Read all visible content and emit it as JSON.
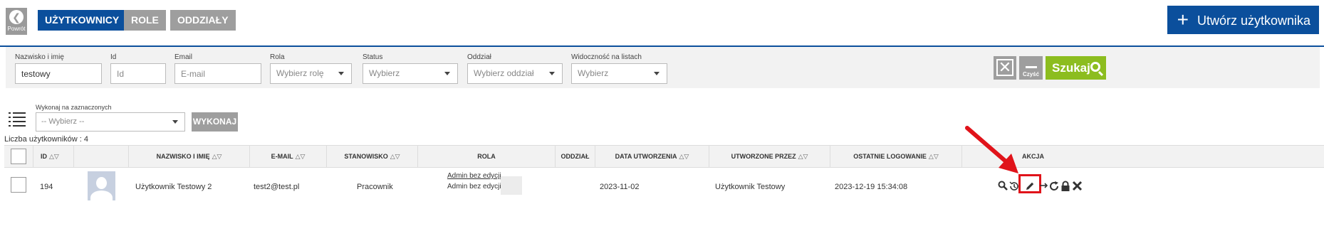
{
  "nav": {
    "back_label": "Powrót",
    "tabs": [
      {
        "label": "UŻYTKOWNICY",
        "active": true
      },
      {
        "label": "ROLE",
        "active": false
      },
      {
        "label": "ODDZIAŁY",
        "active": false
      }
    ],
    "create_label": "Utwórz użytkownika"
  },
  "filters": {
    "name": {
      "label": "Nazwisko i imię",
      "value": "testowy"
    },
    "id": {
      "label": "Id",
      "placeholder": "Id"
    },
    "email": {
      "label": "Email",
      "placeholder": "E-mail"
    },
    "role": {
      "label": "Rola",
      "value": "Wybierz rolę"
    },
    "status": {
      "label": "Status",
      "value": "Wybierz"
    },
    "branch": {
      "label": "Oddział",
      "value": "Wybierz oddział"
    },
    "visibility": {
      "label": "Widoczność na listach",
      "value": "Wybierz"
    },
    "clear_label": "Czyść",
    "search_label": "Szukaj"
  },
  "bulk": {
    "label": "Wykonaj na zaznaczonych",
    "value": "-- Wybierz --",
    "execute_label": "WYKONAJ"
  },
  "count_text": "Liczba użytkowników : 4",
  "table": {
    "columns": [
      "ID",
      "NAZWISKO I IMIĘ",
      "E-MAIL",
      "STANOWISKO",
      "ROLA",
      "ODDZIAŁ",
      "DATA UTWORZENIA",
      "UTWORZONE PRZEZ",
      "OSTATNIE LOGOWANIE",
      "AKCJA"
    ],
    "rows": [
      {
        "id": "194",
        "name": "Użytkownik Testowy 2",
        "email": "test2@test.pl",
        "position": "Pracownik",
        "roles": [
          "Admin bez edycji",
          "Admin bez edycji"
        ],
        "branch": "",
        "created": "2023-11-02",
        "created_by": "Użytkownik Testowy",
        "last_login": "2023-12-19 15:34:08"
      }
    ],
    "actions": [
      "search-icon",
      "history-icon",
      "edit-icon",
      "arrow-right-icon",
      "refresh-icon",
      "lock-icon",
      "delete-icon"
    ]
  },
  "colors": {
    "primary": "#0b4f9c",
    "gray": "#9e9e9e",
    "search": "#8cbd1f",
    "highlight": "#e0131a"
  }
}
